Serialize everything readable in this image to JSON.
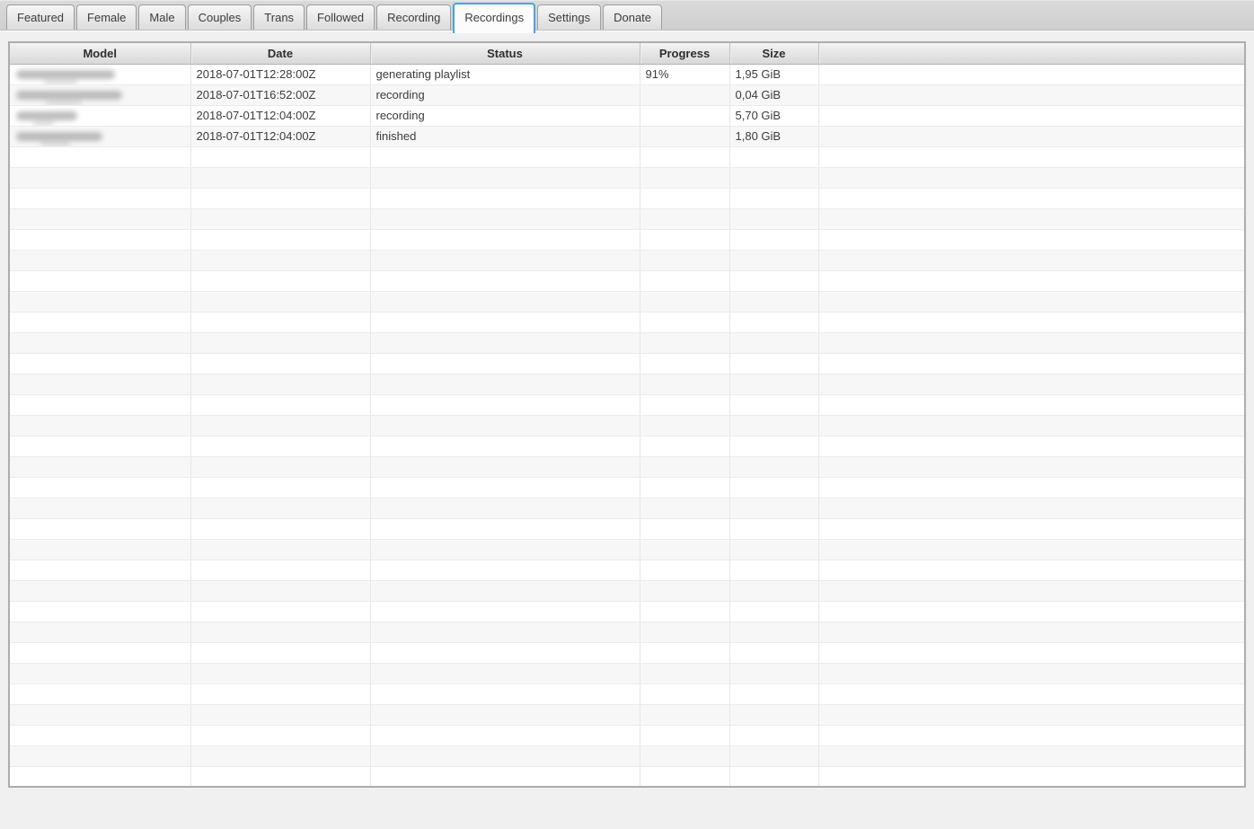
{
  "tabs": {
    "items": [
      {
        "label": "Featured",
        "selected": false
      },
      {
        "label": "Female",
        "selected": false
      },
      {
        "label": "Male",
        "selected": false
      },
      {
        "label": "Couples",
        "selected": false
      },
      {
        "label": "Trans",
        "selected": false
      },
      {
        "label": "Followed",
        "selected": false
      },
      {
        "label": "Recording",
        "selected": false
      },
      {
        "label": "Recordings",
        "selected": true
      },
      {
        "label": "Settings",
        "selected": false
      },
      {
        "label": "Donate",
        "selected": false
      }
    ]
  },
  "table": {
    "columns": [
      "Model",
      "Date",
      "Status",
      "Progress",
      "Size",
      ""
    ],
    "rows": [
      {
        "model_redacted": true,
        "model_blur_width": 110,
        "date": "2018-07-01T12:28:00Z",
        "status": "generating playlist",
        "progress": "91%",
        "size": "1,95 GiB"
      },
      {
        "model_redacted": true,
        "model_blur_width": 118,
        "date": "2018-07-01T16:52:00Z",
        "status": "recording",
        "progress": "",
        "size": "0,04 GiB"
      },
      {
        "model_redacted": true,
        "model_blur_width": 68,
        "date": "2018-07-01T12:04:00Z",
        "status": "recording",
        "progress": "",
        "size": "5,70 GiB"
      },
      {
        "model_redacted": true,
        "model_blur_width": 96,
        "date": "2018-07-01T12:04:00Z",
        "status": "finished",
        "progress": "",
        "size": "1,80 GiB"
      }
    ],
    "empty_row_count": 31
  },
  "colors": {
    "selected_tab_border": "#4ba3da",
    "row_stripe": "#f7f7f7",
    "header_text": "#2e2e2e"
  }
}
